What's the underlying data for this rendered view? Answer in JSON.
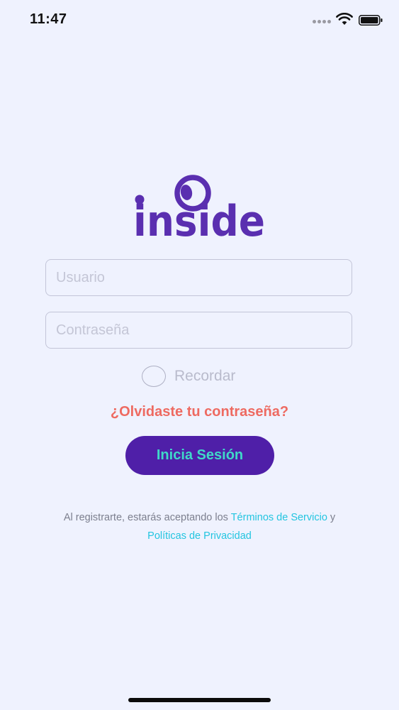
{
  "status_bar": {
    "time": "11:47"
  },
  "brand": {
    "logo_text": "inside",
    "logo_color": "#5a2fb0"
  },
  "form": {
    "username_placeholder": "Usuario",
    "username_value": "",
    "password_placeholder": "Contraseña",
    "password_value": "",
    "remember_label": "Recordar",
    "remember_checked": false,
    "forgot_label": "¿Olvidaste tu contraseña?",
    "login_label": "Inicia Sesión"
  },
  "legal": {
    "prefix": "Al registrarte, estarás aceptando los ",
    "terms_label": "Términos de Servicio",
    "joiner": " y",
    "privacy_label": "Políticas de Privacidad"
  },
  "colors": {
    "background": "#eff2fe",
    "primary_button": "#4f1fa8",
    "button_text": "#3fd9c8",
    "forgot_link": "#ee6a61",
    "legal_link": "#23c5e0"
  }
}
